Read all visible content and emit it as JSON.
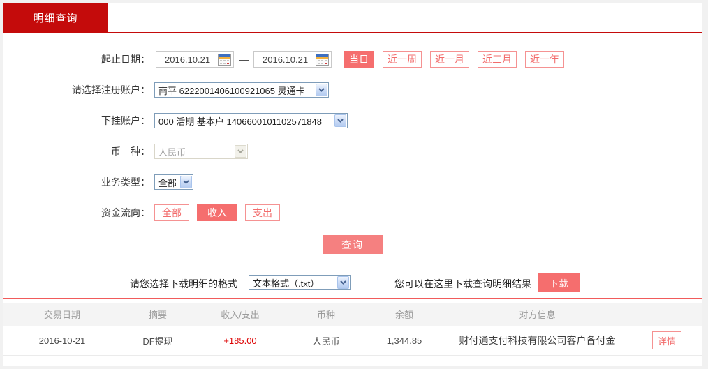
{
  "tab": {
    "label": "明细查询"
  },
  "colors": {
    "brand_red": "#c40b0b",
    "pink_fill": "#f56e6e",
    "pink_border": "#f59292",
    "table_topline": "#f15b5b",
    "amount_red": "#dd0000"
  },
  "form": {
    "date_row": {
      "label": "起止日期：",
      "start_value": "2016.10.21",
      "end_value": "2016.10.21",
      "separator": "—",
      "quick_buttons": [
        {
          "label": "当日",
          "active": true
        },
        {
          "label": "近一周",
          "active": false
        },
        {
          "label": "近一月",
          "active": false
        },
        {
          "label": "近三月",
          "active": false
        },
        {
          "label": "近一年",
          "active": false
        }
      ]
    },
    "register_account": {
      "label": "请选择注册账户：",
      "value": "南平 6222001406100921065 灵通卡"
    },
    "sub_account": {
      "label": "下挂账户：",
      "value": "000 活期 基本户 1406600101102571848"
    },
    "currency": {
      "label": "币　种：",
      "value": "人民币",
      "disabled": true
    },
    "business_type": {
      "label": "业务类型：",
      "value": "全部"
    },
    "fund_flow": {
      "label": "资金流向：",
      "options": [
        {
          "label": "全部",
          "active": false
        },
        {
          "label": "收入",
          "active": true
        },
        {
          "label": "支出",
          "active": false
        }
      ]
    },
    "query_button": "查询"
  },
  "download": {
    "format_label": "请您选择下载明细的格式",
    "format_value": "文本格式（.txt）",
    "hint": "您可以在这里下载查询明细结果",
    "button": "下载"
  },
  "table": {
    "headers": [
      "交易日期",
      "摘要",
      "收入/支出",
      "币种",
      "余额",
      "对方信息"
    ],
    "rows": [
      {
        "date": "2016-10-21",
        "summary": "DF提现",
        "amount": "+185.00",
        "currency": "人民币",
        "balance": "1,344.85",
        "counterparty": "财付通支付科技有限公司客户备付金",
        "action": "详情"
      }
    ]
  }
}
